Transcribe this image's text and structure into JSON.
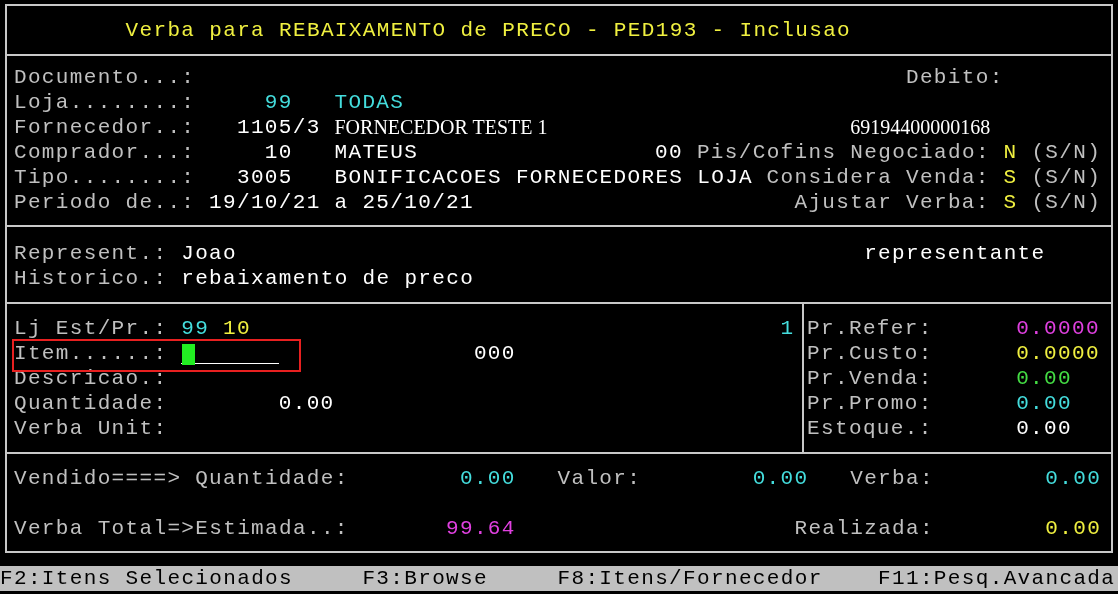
{
  "title": {
    "text": "Verba para REBAIXAMENTO de PRECO - PED193 - Inclusao",
    "color": "#f0f040"
  },
  "sections": [
    {
      "kind": "form",
      "lines": [
        [
          {
            "kind": "text",
            "text": "Documento...:",
            "color": "#c0c0c0"
          },
          {
            "kind": "text",
            "text": "Debito:",
            "color": "#c0c0c0"
          }
        ],
        [
          {
            "kind": "text",
            "text": "Loja........:",
            "color": "#c0c0c0"
          },
          {
            "kind": "text",
            "text": "99",
            "color": "#44dddd"
          },
          {
            "kind": "text",
            "text": "TODAS",
            "color": "#44dddd"
          }
        ],
        [
          {
            "kind": "text",
            "text": "Fornecedor..:",
            "color": "#c0c0c0"
          },
          {
            "kind": "text",
            "text": "1105/3",
            "color": "#ffffff"
          },
          {
            "kind": "serif",
            "text": "FORNECEDOR TESTE 1",
            "color": "#ffffff"
          },
          {
            "kind": "serif",
            "text": "69194400000168",
            "color": "#ffffff"
          }
        ],
        [
          {
            "kind": "text",
            "text": "Comprador...:",
            "color": "#c0c0c0"
          },
          {
            "kind": "text",
            "text": "10",
            "color": "#ffffff"
          },
          {
            "kind": "text",
            "text": "MATEUS",
            "color": "#ffffff"
          },
          {
            "kind": "text",
            "text": "00",
            "color": "#ffffff"
          },
          {
            "kind": "text",
            "text": "Pis/Cofins Negociado:",
            "color": "#c0c0c0"
          },
          {
            "kind": "text",
            "text": "N",
            "color": "#f0f040"
          },
          {
            "kind": "text",
            "text": "(S/N)",
            "color": "#c0c0c0"
          }
        ],
        [
          {
            "kind": "text",
            "text": "Tipo........:",
            "color": "#c0c0c0"
          },
          {
            "kind": "text",
            "text": "3005",
            "color": "#ffffff"
          },
          {
            "kind": "text",
            "text": "BONIFICACOES FORNECEDORES LOJA",
            "color": "#ffffff"
          },
          {
            "kind": "text",
            "text": "Considera Venda:",
            "color": "#c0c0c0"
          },
          {
            "kind": "text",
            "text": "S",
            "color": "#f0f040"
          },
          {
            "kind": "text",
            "text": "(S/N)",
            "color": "#c0c0c0"
          }
        ],
        [
          {
            "kind": "text",
            "text": "Periodo de..:",
            "color": "#c0c0c0"
          },
          {
            "kind": "text",
            "text": "19/10/21",
            "color": "#ffffff"
          },
          {
            "kind": "text",
            "text": "a",
            "color": "#ffffff"
          },
          {
            "kind": "text",
            "text": "25/10/21",
            "color": "#ffffff"
          },
          {
            "kind": "text",
            "text": "Ajustar Verba:",
            "color": "#c0c0c0"
          },
          {
            "kind": "text",
            "text": "S",
            "color": "#f0f040"
          },
          {
            "kind": "text",
            "text": "(S/N)",
            "color": "#c0c0c0"
          }
        ]
      ]
    },
    {
      "kind": "form",
      "lines": [
        [
          {
            "kind": "text",
            "text": "Represent.:",
            "color": "#c0c0c0"
          },
          {
            "kind": "text",
            "text": "Joao",
            "color": "#ffffff"
          },
          {
            "kind": "text",
            "text": "representante",
            "color": "#ffffff"
          }
        ],
        [
          {
            "kind": "text",
            "text": "Historico.:",
            "color": "#c0c0c0"
          },
          {
            "kind": "text",
            "text": "rebaixamento de preco",
            "color": "#ffffff"
          }
        ]
      ]
    },
    {
      "kind": "split",
      "left": {
        "lines": [
          [
            {
              "kind": "text",
              "text": "Lj Est/Pr.:",
              "color": "#c0c0c0"
            },
            {
              "kind": "text",
              "text": "99",
              "color": "#44dddd"
            },
            {
              "kind": "text",
              "text": "10",
              "color": "#f0f040"
            },
            {
              "kind": "text",
              "text": "1",
              "color": "#44dddd"
            }
          ],
          [
            {
              "kind": "text",
              "text": "Item......:",
              "color": "#c0c0c0"
            },
            {
              "kind": "input",
              "focused": true,
              "highlighted": true
            },
            {
              "kind": "text",
              "text": "000",
              "color": "#ffffff"
            }
          ],
          [
            {
              "kind": "text",
              "text": "Descricao.:",
              "color": "#c0c0c0"
            }
          ],
          [
            {
              "kind": "text",
              "text": "Quantidade:",
              "color": "#c0c0c0"
            },
            {
              "kind": "text",
              "text": "0.00",
              "color": "#ffffff"
            }
          ],
          [
            {
              "kind": "text",
              "text": "Verba Unit:",
              "color": "#c0c0c0"
            }
          ]
        ]
      },
      "right": {
        "lines": [
          [
            {
              "kind": "text",
              "text": "Pr.Refer:",
              "color": "#c0c0c0"
            },
            {
              "kind": "text",
              "text": "0.0000",
              "color": "#e040e0"
            }
          ],
          [
            {
              "kind": "text",
              "text": "Pr.Custo:",
              "color": "#c0c0c0"
            },
            {
              "kind": "text",
              "text": "0.0000",
              "color": "#f0f040"
            }
          ],
          [
            {
              "kind": "text",
              "text": "Pr.Venda:",
              "color": "#c0c0c0"
            },
            {
              "kind": "text",
              "text": "0.00",
              "color": "#44dd44"
            }
          ],
          [
            {
              "kind": "text",
              "text": "Pr.Promo:",
              "color": "#c0c0c0"
            },
            {
              "kind": "text",
              "text": "0.00",
              "color": "#44dddd"
            }
          ],
          [
            {
              "kind": "text",
              "text": "Estoque.:",
              "color": "#c0c0c0"
            },
            {
              "kind": "text",
              "text": "0.00",
              "color": "#ffffff"
            }
          ]
        ]
      }
    },
    {
      "kind": "form",
      "lines": [
        [
          {
            "kind": "text",
            "text": "Vendido====>",
            "color": "#c0c0c0"
          },
          {
            "kind": "text",
            "text": "Quantidade:",
            "color": "#c0c0c0"
          },
          {
            "kind": "text",
            "text": "0.00",
            "color": "#44dddd"
          },
          {
            "kind": "text",
            "text": "Valor:",
            "color": "#c0c0c0"
          },
          {
            "kind": "text",
            "text": "0.00",
            "color": "#44dddd"
          },
          {
            "kind": "text",
            "text": "Verba:",
            "color": "#c0c0c0"
          },
          {
            "kind": "text",
            "text": "0.00",
            "color": "#44dddd"
          }
        ],
        [
          {
            "kind": "text",
            "text": "Verba Total=>Estimada..:",
            "color": "#c0c0c0"
          },
          {
            "kind": "text",
            "text": "99.64",
            "color": "#e040e0"
          },
          {
            "kind": "text",
            "text": "Realizada:",
            "color": "#c0c0c0"
          },
          {
            "kind": "text",
            "text": "0.00",
            "color": "#f0f040"
          }
        ]
      ]
    }
  ],
  "function_keys": [
    "F2:Itens Selecionados",
    "F3:Browse",
    "F8:Itens/Fornecedor",
    "F11:Pesq.Avancada"
  ]
}
